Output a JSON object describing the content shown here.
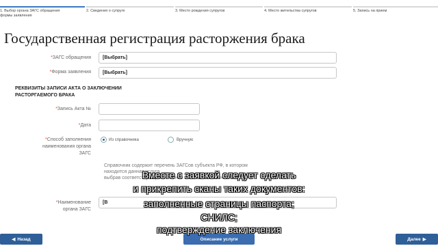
{
  "steps": [
    {
      "label": "1. Выбор органа ЗАГС обращения и формы заявления",
      "line1": "1. Выбор органа ЗАГС обращения",
      "line2": "формы заявления",
      "active": true
    },
    {
      "label": "2. Сведения о супруге",
      "active": false
    },
    {
      "label": "3. Место рождения супругов",
      "active": false
    },
    {
      "label": "4. Место жительства супругов",
      "active": false
    },
    {
      "label": "5. Запись на прием",
      "active": false
    }
  ],
  "page_title": "Государственная регистрация расторжения брака",
  "form": {
    "zags_label": "ЗАГС обращения",
    "zags_value": "[Выбрать]",
    "form_type_label": "Форма заявления",
    "form_type_value": "[Выбрать]",
    "section_title_line1": "РЕКВИЗИТЫ ЗАПИСИ АКТА О ЗАКЛЮЧЕНИИ",
    "section_title_line2": "РАСТОРГАЕМОГО БРАКА",
    "act_number_label": "Запись Акта №",
    "date_label": "Дата",
    "fill_method_label_line1": "Способ заполнения",
    "fill_method_label_line2": "наименования органа",
    "fill_method_label_line3": "ЗАГС",
    "option_directory": "Из справочника",
    "option_manual": "Вручную",
    "hint_line1": "Справочник содержит перечень ЗАГСов субъекта РФ, в котором",
    "hint_line2": "находится данная услуга",
    "hint_line3": "выбрав соответствующее значение в способе заполнения",
    "zags_name_label_line1": "Наименование",
    "zags_name_label_line2": "органа ЗАГС",
    "zags_name_value": "[В"
  },
  "nav": {
    "back": "Назад",
    "description": "Описание услуги",
    "next": "Далее"
  },
  "subtitles": [
    "Вместе с заявкой следует сделать",
    "и прикрепить сканы таких документов:",
    "заполненные страницы паспорта;",
    "СНИЛС;",
    "подтверждение заключения"
  ],
  "colors": {
    "accent": "#2f5f98",
    "required": "#e04a2a",
    "step_active": "#3a78c3"
  }
}
